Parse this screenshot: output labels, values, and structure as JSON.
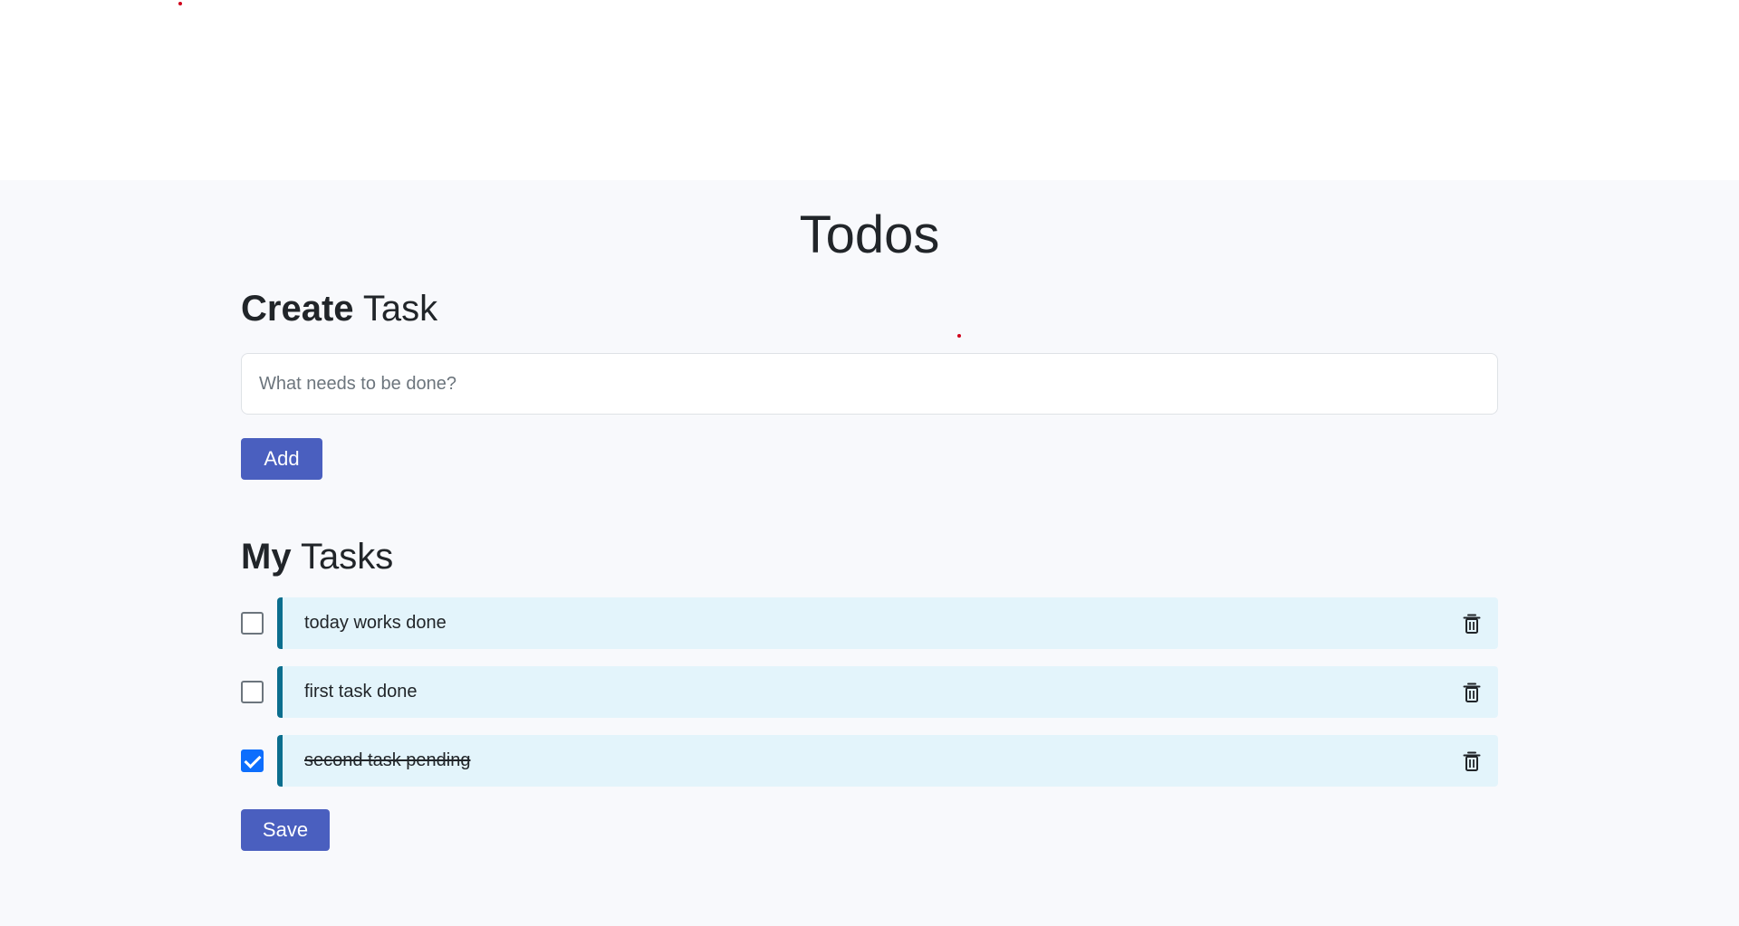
{
  "page": {
    "title": "Todos"
  },
  "create_section": {
    "heading_bold": "Create",
    "heading_rest": " Task",
    "input_placeholder": "What needs to be done?",
    "input_value": "",
    "add_label": "Add"
  },
  "tasks_section": {
    "heading_bold": "My",
    "heading_rest": " Tasks",
    "tasks": [
      {
        "text": "today works done",
        "completed": false
      },
      {
        "text": "first task done",
        "completed": false
      },
      {
        "text": "second task pending",
        "completed": true
      }
    ],
    "save_label": "Save"
  },
  "colors": {
    "accent_button": "#4a5fbf",
    "task_card_bg": "#e3f4fb",
    "task_card_border": "#0b6e8e",
    "checkbox_checked": "#0d6efd"
  },
  "icons": {
    "delete": "trash-icon"
  }
}
